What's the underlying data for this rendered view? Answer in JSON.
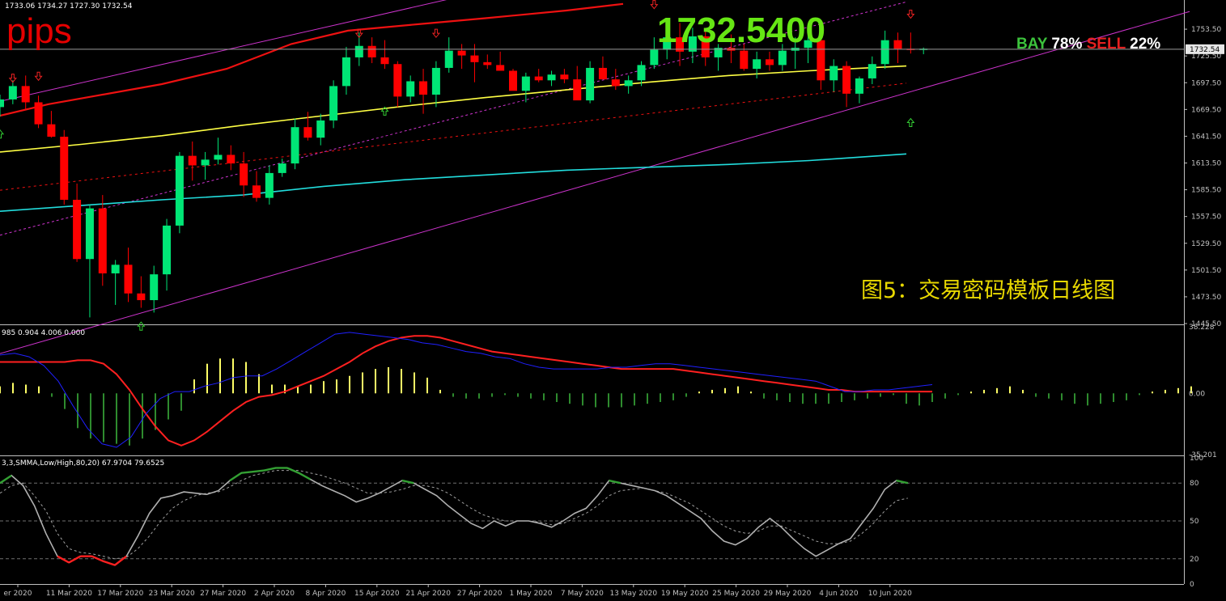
{
  "header": {
    "ohlc": "1733.06 1734.27 1727.30 1732.54",
    "pips": "pips",
    "current_price": "1732.5400",
    "sentiment": {
      "buy_label": "BAY",
      "buy_pct": "78%",
      "sell_label": "SELL",
      "sell_pct": "22%"
    },
    "caption": "图5：交易密码模板日线图"
  },
  "macd_label": "985 0.904 4.006 0.000",
  "stoch_label": "3,3,SMMA,Low/High,80,20) 67.9704 79.6525",
  "chart_data": [
    {
      "type": "candlestick",
      "ylim": [
        1445.5,
        1781.5
      ],
      "y_ticks": [
        "1753.50",
        "1725.50",
        "1697.50",
        "1669.50",
        "1641.50",
        "1613.50",
        "1585.50",
        "1557.50",
        "1529.50",
        "1501.50",
        "1473.50",
        "1445.50"
      ],
      "current_price_tag": "1732.54",
      "x_labels": [
        "er 2020",
        "11 Mar 2020",
        "17 Mar 2020",
        "23 Mar 2020",
        "27 Mar 2020",
        "2 Apr 2020",
        "8 Apr 2020",
        "15 Apr 2020",
        "21 Apr 2020",
        "27 Apr 2020",
        "1 May 2020",
        "7 May 2020",
        "13 May 2020",
        "19 May 2020",
        "25 May 2020",
        "29 May 2020",
        "4 Jun 2020",
        "10 Jun 2020"
      ],
      "colors": {
        "up": "#00e676",
        "down": "#ff0000",
        "ma_fast": "#ee1111",
        "ma_mid": "#ffff44",
        "ma_slow": "#22dddd",
        "channel": "#cc33cc"
      },
      "candles": [
        [
          1672,
          1685,
          1662,
          1680
        ],
        [
          1680,
          1700,
          1675,
          1694
        ],
        [
          1694,
          1705,
          1670,
          1677
        ],
        [
          1677,
          1684,
          1650,
          1654
        ],
        [
          1654,
          1668,
          1640,
          1641
        ],
        [
          1641,
          1648,
          1570,
          1575
        ],
        [
          1575,
          1592,
          1510,
          1513
        ],
        [
          1513,
          1570,
          1452,
          1566
        ],
        [
          1566,
          1580,
          1485,
          1498
        ],
        [
          1498,
          1512,
          1465,
          1507
        ],
        [
          1507,
          1525,
          1468,
          1477
        ],
        [
          1477,
          1495,
          1462,
          1470
        ],
        [
          1470,
          1506,
          1457,
          1497
        ],
        [
          1497,
          1555,
          1480,
          1548
        ],
        [
          1548,
          1625,
          1540,
          1621
        ],
        [
          1621,
          1636,
          1595,
          1611
        ],
        [
          1611,
          1625,
          1596,
          1617
        ],
        [
          1617,
          1640,
          1612,
          1622
        ],
        [
          1622,
          1632,
          1606,
          1613
        ],
        [
          1613,
          1625,
          1578,
          1590
        ],
        [
          1590,
          1605,
          1573,
          1577
        ],
        [
          1577,
          1611,
          1570,
          1603
        ],
        [
          1603,
          1618,
          1599,
          1613
        ],
        [
          1613,
          1660,
          1607,
          1651
        ],
        [
          1651,
          1667,
          1637,
          1640
        ],
        [
          1640,
          1665,
          1632,
          1658
        ],
        [
          1658,
          1700,
          1650,
          1694
        ],
        [
          1694,
          1735,
          1685,
          1724
        ],
        [
          1724,
          1750,
          1715,
          1736
        ],
        [
          1736,
          1745,
          1718,
          1724
        ],
        [
          1724,
          1742,
          1712,
          1717
        ],
        [
          1717,
          1720,
          1672,
          1683
        ],
        [
          1683,
          1705,
          1677,
          1699
        ],
        [
          1699,
          1712,
          1665,
          1685
        ],
        [
          1685,
          1720,
          1672,
          1713
        ],
        [
          1713,
          1745,
          1708,
          1731
        ],
        [
          1731,
          1738,
          1712,
          1726
        ],
        [
          1726,
          1738,
          1698,
          1719
        ],
        [
          1719,
          1727,
          1712,
          1716
        ],
        [
          1716,
          1730,
          1710,
          1710
        ],
        [
          1710,
          1712,
          1690,
          1689
        ],
        [
          1689,
          1708,
          1677,
          1704
        ],
        [
          1704,
          1712,
          1698,
          1700
        ],
        [
          1700,
          1710,
          1694,
          1706
        ],
        [
          1706,
          1712,
          1697,
          1701
        ],
        [
          1701,
          1715,
          1685,
          1679
        ],
        [
          1679,
          1720,
          1676,
          1713
        ],
        [
          1713,
          1725,
          1702,
          1701
        ],
        [
          1701,
          1712,
          1690,
          1694
        ],
        [
          1694,
          1705,
          1686,
          1700
        ],
        [
          1700,
          1720,
          1694,
          1716
        ],
        [
          1716,
          1745,
          1712,
          1732
        ],
        [
          1732,
          1760,
          1722,
          1745
        ],
        [
          1745,
          1760,
          1715,
          1730
        ],
        [
          1730,
          1755,
          1718,
          1746
        ],
        [
          1746,
          1752,
          1715,
          1724
        ],
        [
          1724,
          1738,
          1710,
          1734
        ],
        [
          1734,
          1748,
          1718,
          1731
        ],
        [
          1731,
          1738,
          1710,
          1712
        ],
        [
          1712,
          1730,
          1702,
          1722
        ],
        [
          1722,
          1730,
          1710,
          1716
        ],
        [
          1716,
          1738,
          1710,
          1731
        ],
        [
          1731,
          1745,
          1712,
          1734
        ],
        [
          1734,
          1748,
          1718,
          1742
        ],
        [
          1742,
          1752,
          1690,
          1700
        ],
        [
          1700,
          1722,
          1688,
          1715
        ],
        [
          1715,
          1720,
          1672,
          1686
        ],
        [
          1686,
          1704,
          1676,
          1702
        ],
        [
          1702,
          1725,
          1696,
          1717
        ],
        [
          1717,
          1752,
          1712,
          1742
        ],
        [
          1742,
          1750,
          1718,
          1733
        ],
        [
          1733,
          1750,
          1728,
          1732
        ],
        [
          1732.54,
          1734.27,
          1727.3,
          1733.06
        ]
      ],
      "up_arrows": [
        [
          0,
          1648
        ],
        [
          11,
          1447
        ],
        [
          30,
          1672
        ],
        [
          71,
          1660
        ]
      ],
      "down_arrows": [
        [
          1,
          1698
        ],
        [
          3,
          1700
        ],
        [
          28,
          1745
        ],
        [
          34,
          1745
        ],
        [
          51,
          1775
        ],
        [
          71,
          1765
        ]
      ]
    },
    {
      "type": "histogram",
      "name": "MACD",
      "ylim": [
        -35.201,
        38.228
      ],
      "y_ticks": [
        "38.228",
        "0.00",
        "-35.201"
      ],
      "colors": {
        "positive": "#ffff66",
        "negative": "#2e8b2e",
        "signal": "#ff2020",
        "main": "#2020ff"
      },
      "values": [
        4,
        6,
        5,
        4,
        -2,
        -9,
        -20,
        -26,
        -28,
        -29,
        -30,
        -26,
        -21,
        -15,
        -10,
        8,
        17,
        20,
        20,
        18,
        11,
        5,
        5,
        4,
        5,
        7,
        8,
        10,
        12,
        14,
        15,
        14,
        12,
        9,
        2,
        -2,
        -3,
        -3,
        -2,
        -1,
        -2,
        -3,
        -4,
        -5,
        -6,
        -7,
        -8,
        -8,
        -8,
        -7,
        -6,
        -5,
        -4,
        -2,
        1,
        2,
        3,
        4,
        1,
        -3,
        -4,
        -5,
        -6,
        -6,
        -6,
        -5,
        -4,
        -3,
        -2,
        -1,
        -6,
        -7,
        -5,
        -3,
        -1,
        1,
        2,
        3,
        4,
        2,
        -2,
        -3,
        -4,
        -6,
        -7,
        -6,
        -5,
        -4,
        -1,
        1,
        2,
        3,
        4
      ],
      "signal": [
        18,
        18,
        18,
        18,
        18,
        18,
        19,
        19,
        17,
        11,
        2,
        -9,
        -19,
        -27,
        -30,
        -27,
        -22,
        -16,
        -10,
        -5,
        -2,
        -1,
        1,
        4,
        7,
        10,
        14,
        18,
        23,
        27,
        30,
        32,
        33,
        33,
        32,
        30,
        28,
        26,
        24,
        23,
        22,
        21,
        20,
        19,
        18,
        17,
        16,
        15,
        14,
        14,
        14,
        14,
        14,
        13,
        12,
        11,
        10,
        9,
        8,
        7,
        6,
        5,
        4,
        3,
        2,
        2,
        1,
        1,
        1,
        1,
        1,
        1,
        1
      ],
      "main": [
        22,
        23,
        21,
        16,
        7,
        -7,
        -20,
        -29,
        -31,
        -25,
        -12,
        -3,
        1,
        1,
        4,
        6,
        9,
        10,
        10,
        14,
        19,
        24,
        29,
        34,
        35,
        34,
        33,
        32,
        31,
        29,
        28,
        26,
        24,
        23,
        21,
        20,
        17,
        15,
        14,
        14,
        14,
        14,
        15,
        15,
        16,
        17,
        17,
        16,
        15,
        14,
        13,
        12,
        11,
        10,
        9,
        8,
        7,
        4,
        1,
        1,
        2,
        2,
        3,
        4,
        5
      ]
    },
    {
      "type": "line",
      "name": "Stochastic",
      "ylim": [
        0,
        100
      ],
      "y_ticks": [
        "100",
        "80",
        "50",
        "20",
        "0"
      ],
      "levels": [
        80,
        50,
        20
      ],
      "colors": {
        "main": "#b0b0b0",
        "overbought": "#33a033",
        "oversold": "#ff2020",
        "signal": "#a0a0a0"
      },
      "main": [
        80,
        86,
        78,
        62,
        40,
        22,
        17,
        22,
        22,
        18,
        15,
        22,
        38,
        56,
        68,
        70,
        73,
        72,
        71,
        74,
        82,
        88,
        89,
        90,
        92,
        92,
        88,
        83,
        78,
        74,
        70,
        65,
        68,
        72,
        77,
        82,
        80,
        75,
        70,
        62,
        55,
        48,
        44,
        50,
        46,
        50,
        50,
        48,
        45,
        50,
        56,
        60,
        70,
        82,
        80,
        78,
        76,
        74,
        70,
        64,
        58,
        52,
        42,
        34,
        31,
        36,
        45,
        52,
        45,
        36,
        28,
        22,
        27,
        32,
        36,
        48,
        60,
        75,
        82,
        80
      ],
      "signal": [
        72,
        78,
        80,
        70,
        58,
        40,
        28,
        25,
        24,
        22,
        20,
        21,
        28,
        38,
        50,
        60,
        66,
        70,
        72,
        73,
        77,
        82,
        86,
        88,
        90,
        90,
        90,
        88,
        86,
        83,
        80,
        76,
        72,
        72,
        73,
        75,
        78,
        78,
        76,
        72,
        66,
        60,
        55,
        52,
        50,
        50,
        50,
        49,
        47,
        48,
        52,
        56,
        62,
        70,
        74,
        75,
        76,
        74,
        72,
        68,
        64,
        58,
        52,
        46,
        42,
        40,
        42,
        46,
        46,
        42,
        38,
        34,
        32,
        32,
        34,
        40,
        48,
        58,
        66,
        68
      ]
    }
  ]
}
